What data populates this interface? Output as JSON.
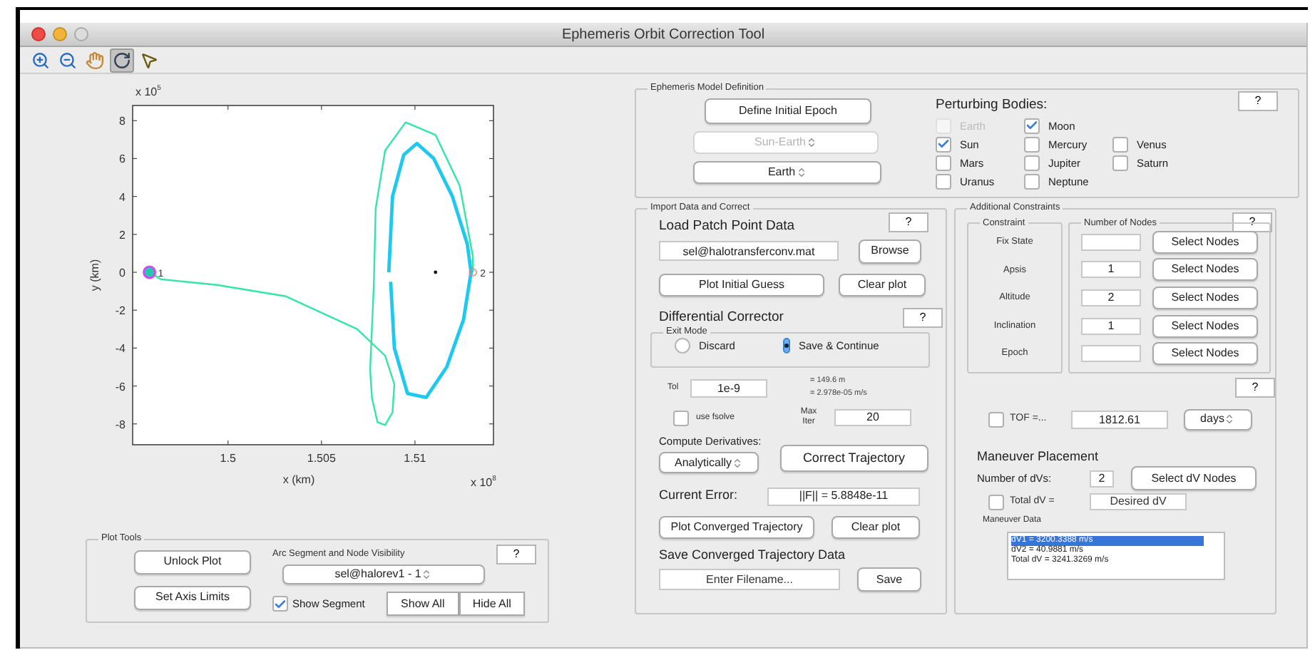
{
  "window": {
    "title": "Ephemeris Orbit Correction Tool"
  },
  "toolbar": [
    {
      "kind": "zoom-in",
      "selected": false
    },
    {
      "kind": "zoom-out",
      "selected": false
    },
    {
      "kind": "pan",
      "selected": false
    },
    {
      "kind": "rotate",
      "selected": true
    },
    {
      "kind": "data-cursor",
      "selected": false
    }
  ],
  "plot": {
    "x_multiplier": {
      "base": "x 10",
      "exponent": "8"
    },
    "y_multiplier": {
      "base": "x 10",
      "exponent": "5"
    },
    "point_labels": [
      "1",
      "2"
    ],
    "chart_data": {
      "type": "line",
      "xlabel": "x (km)",
      "ylabel": "y (km)",
      "xlim": [
        1.4949,
        1.5142
      ],
      "ylim": [
        -9.1,
        8.8
      ],
      "xticks": [
        1.5,
        1.505,
        1.51
      ],
      "yticks": [
        -8,
        -6,
        -4,
        -2,
        0,
        2,
        4,
        6,
        8
      ],
      "series": [
        {
          "color": "#33e6a6",
          "x": [
            1.4958,
            1.4964,
            1.4994,
            1.5031,
            1.5069,
            1.5084,
            1.5089,
            1.5088,
            1.5084,
            1.508,
            1.5077,
            1.5076,
            1.5078,
            1.5079,
            1.5084,
            1.5095,
            1.5111,
            1.5124,
            1.5131,
            1.5131
          ],
          "values": [
            0,
            -0.37,
            -0.67,
            -1.27,
            -2.99,
            -4.4,
            -5.9,
            -7.39,
            -8.06,
            -7.91,
            -6.64,
            -5.15,
            -0.67,
            3.36,
            6.42,
            7.91,
            7.24,
            4.55,
            0.82,
            0
          ]
        },
        {
          "color": "#1ec8ee",
          "x": [
            1.5086,
            1.5088,
            1.5094,
            1.5101,
            1.511,
            1.512,
            1.5128,
            1.513,
            1.5126,
            1.5117,
            1.5106,
            1.5096,
            1.5089,
            1.5087
          ],
          "values": [
            0,
            4,
            6.2,
            6.8,
            6.0,
            4.0,
            1.5,
            0,
            -2.5,
            -5,
            -6.6,
            -6.4,
            -4,
            -0.5
          ]
        }
      ]
    }
  },
  "plot_tools": {
    "title": "Plot Tools",
    "help": "?",
    "buttons": [
      "Unlock Plot",
      "Set Axis Limits"
    ],
    "segment_label": "Arc Segment and Node Visibility",
    "segment_select": "sel@halorev1 - 1",
    "show_segment": {
      "label": "Show Segment",
      "checked": true
    },
    "show_all": "Show All",
    "hide_all": "Hide All"
  },
  "ephemeris": {
    "title": "Ephemeris Model Definition",
    "help": "?",
    "define_epoch": "Define Initial Epoch",
    "system": {
      "value": "Sun-Earth",
      "disabled": true
    },
    "central_body": {
      "value": "Earth",
      "disabled": false
    },
    "bodies_label": "Perturbing Bodies:",
    "body_rows": [
      [
        {
          "label": "Earth",
          "checked": false,
          "disabled": true
        },
        {
          "label": "Moon",
          "checked": true,
          "disabled": false
        }
      ],
      [
        {
          "label": "Sun",
          "checked": true,
          "disabled": false
        },
        {
          "label": "Mercury",
          "checked": false,
          "disabled": false
        },
        {
          "label": "Venus",
          "checked": false,
          "disabled": false
        }
      ],
      [
        {
          "label": "Mars",
          "checked": false,
          "disabled": false
        },
        {
          "label": "Jupiter",
          "checked": false,
          "disabled": false
        },
        {
          "label": "Saturn",
          "checked": false,
          "disabled": false
        }
      ],
      [
        {
          "label": "Uranus",
          "checked": false,
          "disabled": false
        },
        {
          "label": "Neptune",
          "checked": false,
          "disabled": false
        }
      ]
    ]
  },
  "import": {
    "title": "Import Data and Correct",
    "help": "?",
    "load_label": "Load Patch Point Data",
    "file": "sel@halotransferconv.mat",
    "browse": "Browse",
    "plot_initial": "Plot Initial Guess",
    "clear_plot_initial": "Clear plot",
    "dc_label": "Differential Corrector",
    "dc_help": "?",
    "exit_mode": {
      "title": "Exit Mode",
      "options": [
        {
          "label": "Discard",
          "selected": false
        },
        {
          "label": "Save & Continue",
          "selected": true
        }
      ]
    },
    "tol_label": "Tol",
    "tol": "1e-9",
    "tol_notes": [
      "= 149.6 m",
      "= 2.978e-05 m/s"
    ],
    "use_fsolve": {
      "label": "use fsolve",
      "checked": false
    },
    "max_iter_label": "Max Iter",
    "max_iter": "20",
    "derivs_label": "Compute Derivatives:",
    "derivs": "Analytically",
    "correct": "Correct Trajectory",
    "error_label": "Current Error:",
    "error": "||F|| = 5.8848e-11",
    "plot_converged": "Plot Converged Trajectory",
    "clear_plot_converged": "Clear plot",
    "save_label": "Save Converged Trajectory Data",
    "filename_placeholder": "Enter Filename...",
    "save": "Save"
  },
  "constraints": {
    "title": "Additional Constraints",
    "help": "?",
    "constraint_title": "Constraint",
    "nodes_title": "Number of Nodes",
    "rows": [
      {
        "name": "Fix State",
        "button": "Select Nodes"
      },
      {
        "name": "Apsis",
        "nodes": "1",
        "button": "Select Nodes"
      },
      {
        "name": "Altitude",
        "nodes": "2",
        "button": "Select Nodes"
      },
      {
        "name": "Inclination",
        "nodes": "1",
        "button": "Select Nodes"
      },
      {
        "name": "Epoch",
        "button": "Select Nodes"
      }
    ],
    "help_2": "?",
    "tof": {
      "label": "TOF =...",
      "checked": false,
      "value": "1812.61",
      "units": "days"
    },
    "maneuver": {
      "title": "Maneuver Placement",
      "count_label": "Number of dVs:",
      "count": "2",
      "select": "Select dV Nodes",
      "total": {
        "label": "Total dV =",
        "checked": false,
        "placeholder": "Desired dV"
      },
      "data_label": "Maneuver Data",
      "data": [
        {
          "text": "dV1 = 3200.3388 m/s",
          "selected": true
        },
        {
          "text": "dV2 = 40.9881 m/s",
          "selected": false
        },
        {
          "text": "Total dV = 3241.3269 m/s",
          "selected": false
        }
      ]
    }
  }
}
